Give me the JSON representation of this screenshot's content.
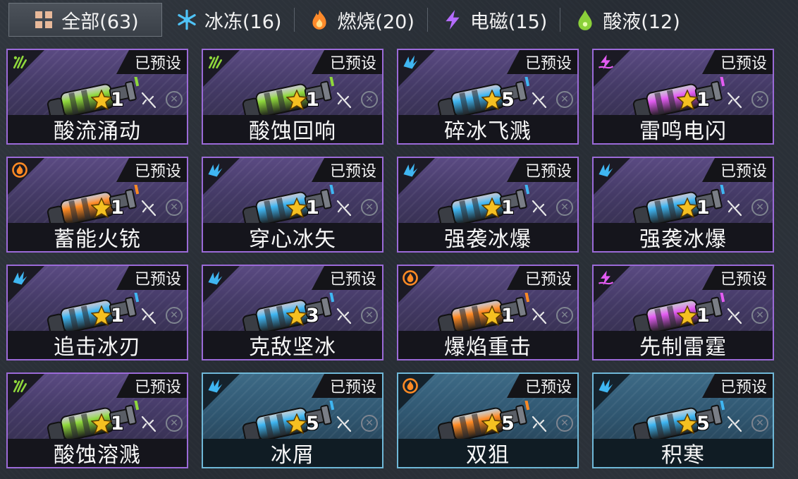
{
  "tabs": [
    {
      "label": "全部(63)",
      "icon": "grid-icon",
      "active": true
    },
    {
      "label": "冰冻(16)",
      "icon": "snowflake-icon",
      "color": "#4fc3f7"
    },
    {
      "label": "燃烧(20)",
      "icon": "flame-icon",
      "color": "#ff8a2a"
    },
    {
      "label": "电磁(15)",
      "icon": "lightning-icon",
      "color": "#b56cff"
    },
    {
      "label": "酸液(12)",
      "icon": "acid-drop-icon",
      "color": "#8bd13a"
    }
  ],
  "preset_label": "已预设",
  "cards": [
    {
      "name": "酸流涌动",
      "stars": "1",
      "element": "acid",
      "frame": "purple"
    },
    {
      "name": "酸蚀回响",
      "stars": "1",
      "element": "acid",
      "frame": "purple"
    },
    {
      "name": "碎冰飞溅",
      "stars": "5",
      "element": "ice",
      "frame": "purple"
    },
    {
      "name": "雷鸣电闪",
      "stars": "1",
      "element": "electric",
      "frame": "purple"
    },
    {
      "name": "蓄能火铳",
      "stars": "1",
      "element": "fire",
      "frame": "purple"
    },
    {
      "name": "穿心冰矢",
      "stars": "1",
      "element": "ice",
      "frame": "purple"
    },
    {
      "name": "强袭冰爆",
      "stars": "1",
      "element": "ice",
      "frame": "purple"
    },
    {
      "name": "强袭冰爆",
      "stars": "1",
      "element": "ice",
      "frame": "purple"
    },
    {
      "name": "追击冰刃",
      "stars": "1",
      "element": "ice",
      "frame": "purple"
    },
    {
      "name": "克敌坚冰",
      "stars": "3",
      "element": "ice",
      "frame": "purple"
    },
    {
      "name": "爆焰重击",
      "stars": "1",
      "element": "fire",
      "frame": "purple"
    },
    {
      "name": "先制雷霆",
      "stars": "1",
      "element": "electric",
      "frame": "purple"
    },
    {
      "name": "酸蚀溶溅",
      "stars": "1",
      "element": "acid",
      "frame": "purple"
    },
    {
      "name": "冰屑",
      "stars": "5",
      "element": "ice",
      "frame": "blue"
    },
    {
      "name": "双狙",
      "stars": "5",
      "element": "fire",
      "frame": "blue"
    },
    {
      "name": "积寒",
      "stars": "5",
      "element": "ice",
      "frame": "blue"
    }
  ],
  "colors": {
    "acid": "#8fd83c",
    "ice": "#3fb6f2",
    "fire": "#ff8a24",
    "electric": "#e35cf2",
    "star": "#f5c021"
  }
}
